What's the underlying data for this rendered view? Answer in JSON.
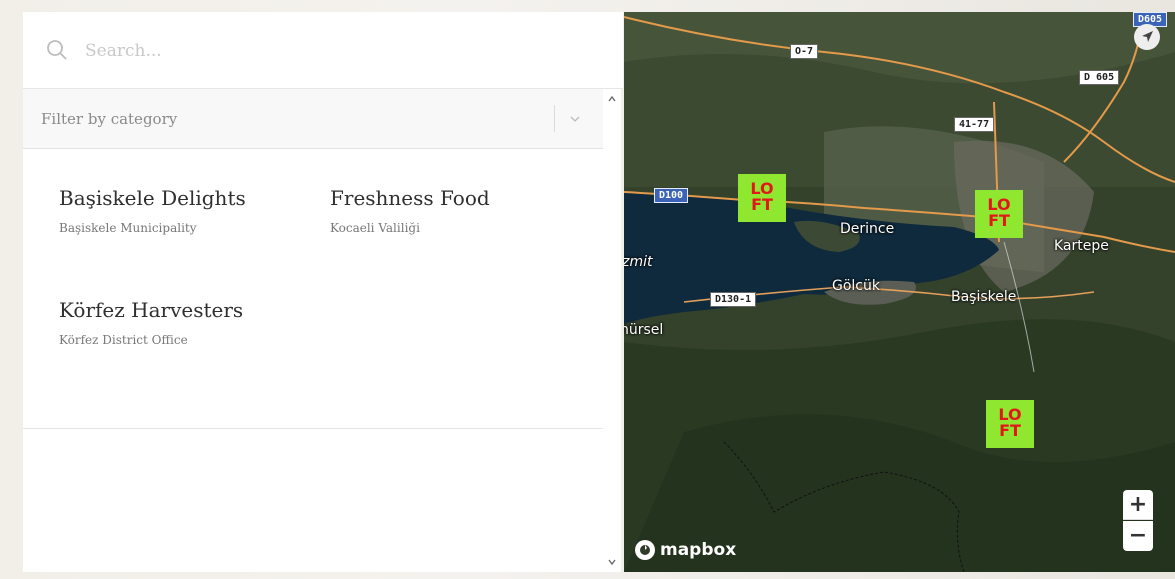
{
  "search": {
    "placeholder": "Search..."
  },
  "filter": {
    "label": "Filter by category"
  },
  "shops": [
    {
      "name": "Başiskele Delights",
      "location": "Başiskele Municipality"
    },
    {
      "name": "Freshness Food",
      "location": "Kocaeli Valiliği"
    },
    {
      "name": "Körfez Harvesters",
      "location": "Körfez District Office"
    }
  ],
  "map": {
    "road_labels": [
      "D605",
      "O-7",
      "D 605",
      "41-77",
      "D100",
      "D130-1"
    ],
    "places": [
      "Derince",
      "Kartepe",
      "İzmit",
      "Gölcük",
      "Başiskele",
      "hürsel"
    ],
    "marker_label": "LO FT",
    "zoom_in": "+",
    "zoom_out": "−",
    "attribution": "mapbox"
  },
  "colors": {
    "marker_bg": "#8fe82f",
    "marker_text": "#e3161b"
  }
}
